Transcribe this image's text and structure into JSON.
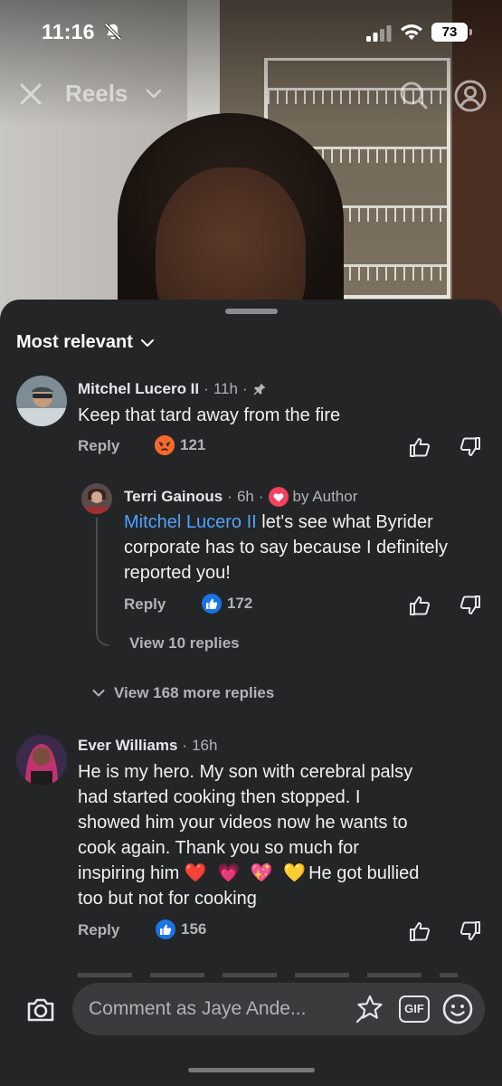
{
  "status_bar": {
    "time": "11:16",
    "battery": "73"
  },
  "reels_header": {
    "title": "Reels"
  },
  "sheet": {
    "sort_label": "Most relevant"
  },
  "comments": [
    {
      "author": "Mitchel Lucero II",
      "time": "11h",
      "separator": "·",
      "text": "Keep that tard away from the fire",
      "reply_label": "Reply",
      "reaction_count": "121",
      "reaction_type": "angry"
    },
    {
      "author": "Terri Gainous",
      "time": "6h",
      "separator": "·",
      "badge": "by Author",
      "mention": "Mitchel Lucero II",
      "text": " let's see what Byrider corporate has to say because I definitely reported you!",
      "reply_label": "Reply",
      "reaction_count": "172",
      "reaction_type": "like",
      "view_replies": "View 10 replies"
    },
    {
      "view_more": "View 168 more replies"
    },
    {
      "author": "Ever Williams",
      "time": "16h",
      "separator": "·",
      "text_line1": "He is my hero. My son with cerebral palsy",
      "text_line2": "had started cooking then stopped. I",
      "text_line3": "showed him your videos now he wants to",
      "text_line4": "cook again. Thank you so much for",
      "text_line5_a": "inspiring him ",
      "emojis": "❤️ 💗 💖 💛",
      "text_line5_b": "He got bullied",
      "text_line6": "too but not for cooking",
      "reply_label": "Reply",
      "reaction_count": "156",
      "reaction_type": "like"
    }
  ],
  "composer": {
    "placeholder": "Comment as Jaye Ande...",
    "gif_label": "GIF"
  },
  "colors": {
    "sheet_bg": "#242526",
    "mention": "#4fa3ff",
    "like_blue": "#1b74e4",
    "angry_orange": "#f0582b"
  }
}
